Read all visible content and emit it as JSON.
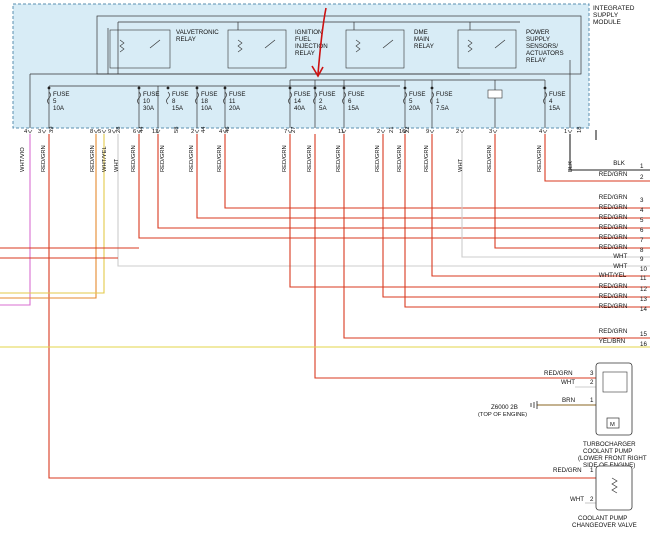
{
  "module": {
    "title_lines": [
      "INTEGRATED",
      "SUPPLY",
      "MODULE"
    ]
  },
  "relays": [
    {
      "lines": [
        "VALVETRONIC",
        "RELAY"
      ]
    },
    {
      "lines": [
        "IGNITION",
        "FUEL",
        "INJECTION",
        "RELAY"
      ]
    },
    {
      "lines": [
        "DME",
        "MAIN",
        "RELAY"
      ]
    },
    {
      "lines": [
        "POWER",
        "SUPPLY",
        "SENSORS/",
        "ACTUATORS",
        "RELAY"
      ]
    }
  ],
  "fuses": [
    {
      "name": "FUSE",
      "number": "5",
      "rating": "10A"
    },
    {
      "name": "FUSE",
      "number": "10",
      "rating": "30A"
    },
    {
      "name": "FUSE",
      "number": "8",
      "rating": "15A"
    },
    {
      "name": "FUSE",
      "number": "18",
      "rating": "10A"
    },
    {
      "name": "FUSE",
      "number": "11",
      "rating": "20A"
    },
    {
      "name": "FUSE",
      "number": "14",
      "rating": "40A"
    },
    {
      "name": "FUSE",
      "number": "2",
      "rating": "5A"
    },
    {
      "name": "FUSE",
      "number": "6",
      "rating": "15A"
    },
    {
      "name": "FUSE",
      "number": "5",
      "rating": "20A"
    },
    {
      "name": "FUSE",
      "number": "1",
      "rating": "7.5A"
    },
    {
      "name": "FUSE",
      "number": "4",
      "rating": "15A"
    }
  ],
  "pins": [
    "4",
    "3",
    "8",
    "5",
    "9",
    "6",
    "12",
    "2",
    "4",
    "7",
    "11",
    "2",
    "10",
    "9",
    "2",
    "3",
    "4",
    "1"
  ],
  "terminal_labels": [
    "39",
    "28",
    "44",
    "58",
    "44",
    "46",
    "27",
    "21",
    "22",
    "18"
  ],
  "wire_labels": [
    "WHT/VIO",
    "RED/GRN",
    "RED/GRN",
    "WHT/YEL",
    "WHT",
    "RED/GRN",
    "RED/GRN",
    "RED/GRN",
    "RED/GRN",
    "RED/GRN",
    "RED/GRN",
    "RED/GRN",
    "RED/GRN",
    "RED/GRN",
    "RED/GRN",
    "WHT",
    "RED/GRN",
    "RED/GRN",
    "BLK"
  ],
  "right_list": [
    {
      "label": "BLK",
      "num": "1"
    },
    {
      "label": "RED/GRN",
      "num": "2"
    },
    {
      "label": "RED/GRN",
      "num": "3"
    },
    {
      "label": "RED/GRN",
      "num": "4"
    },
    {
      "label": "RED/GRN",
      "num": "5"
    },
    {
      "label": "RED/GRN",
      "num": "6"
    },
    {
      "label": "RED/GRN",
      "num": "7"
    },
    {
      "label": "RED/GRN",
      "num": "8"
    },
    {
      "label": "WHT",
      "num": "9"
    },
    {
      "label": "WHT",
      "num": "10"
    },
    {
      "label": "WHT/YEL",
      "num": "11"
    },
    {
      "label": "RED/GRN",
      "num": "12"
    },
    {
      "label": "RED/GRN",
      "num": "13"
    },
    {
      "label": "RED/GRN",
      "num": "14"
    },
    {
      "label": "RED/GRN",
      "num": "15"
    },
    {
      "label": "YEL/BRN",
      "num": "16"
    }
  ],
  "turbo_pump": {
    "pins": [
      {
        "wire": "RED/GRN",
        "pin": "3"
      },
      {
        "wire": "WHT",
        "pin": "2"
      },
      {
        "wire": "BRN",
        "pin": "1"
      }
    ],
    "ground_ref": "Z6000 2B",
    "ground_note": "(TOP OF ENGINE)",
    "motor": "M",
    "title_lines": [
      "TURBOCHARGER",
      "COOLANT PUMP",
      "(LOWER FRONT RIGHT",
      "SIDE OF ENGINE)"
    ]
  },
  "changeover_valve": {
    "pins": [
      {
        "wire": "RED/GRN",
        "pin": "1"
      },
      {
        "wire": "WHT",
        "pin": "2"
      }
    ],
    "title_lines": [
      "COOLANT PUMP",
      "CHANGEOVER VALVE"
    ]
  },
  "colors": {
    "red": "#d9391f",
    "orange": "#e58a2e",
    "white_wire": "#cccccc",
    "yellow": "#e3d44a",
    "violet": "#d86fd0",
    "brown": "#8a6420",
    "black": "#222222",
    "module_bg": "#d8ecf6",
    "module_border": "#5a8fb0",
    "arrow": "#cc1111"
  }
}
